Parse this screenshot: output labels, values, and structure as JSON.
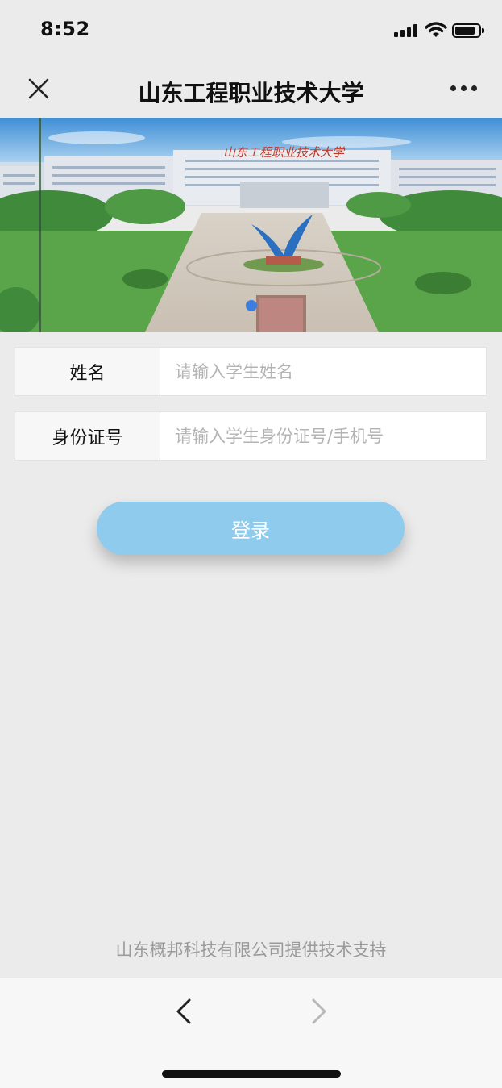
{
  "status_bar": {
    "time": "8:52",
    "icons": [
      "signal-icon",
      "wifi-icon",
      "battery-icon"
    ]
  },
  "nav": {
    "title": "山东工程职业技术大学",
    "close_icon": "close-icon",
    "more_icon": "more-icon"
  },
  "banner": {
    "school_sign": "山东工程职业技术大学",
    "carousel_active_index": 0
  },
  "form": {
    "name": {
      "label": "姓名",
      "placeholder": "请输入学生姓名",
      "value": ""
    },
    "id": {
      "label": "身份证号",
      "placeholder": "请输入学生身份证号/手机号",
      "value": ""
    }
  },
  "login_button": {
    "label": "登录"
  },
  "footer": {
    "credit": "山东概邦科技有限公司提供技术支持"
  },
  "bottom_nav": {
    "back_icon": "chevron-left-icon",
    "forward_icon": "chevron-right-icon"
  },
  "colors": {
    "page_bg": "#ebebeb",
    "button_bg": "#8ecbec",
    "carousel_dot": "#3b7ee0",
    "placeholder": "#b3b3b3",
    "footer_text": "#9a9a9a"
  }
}
